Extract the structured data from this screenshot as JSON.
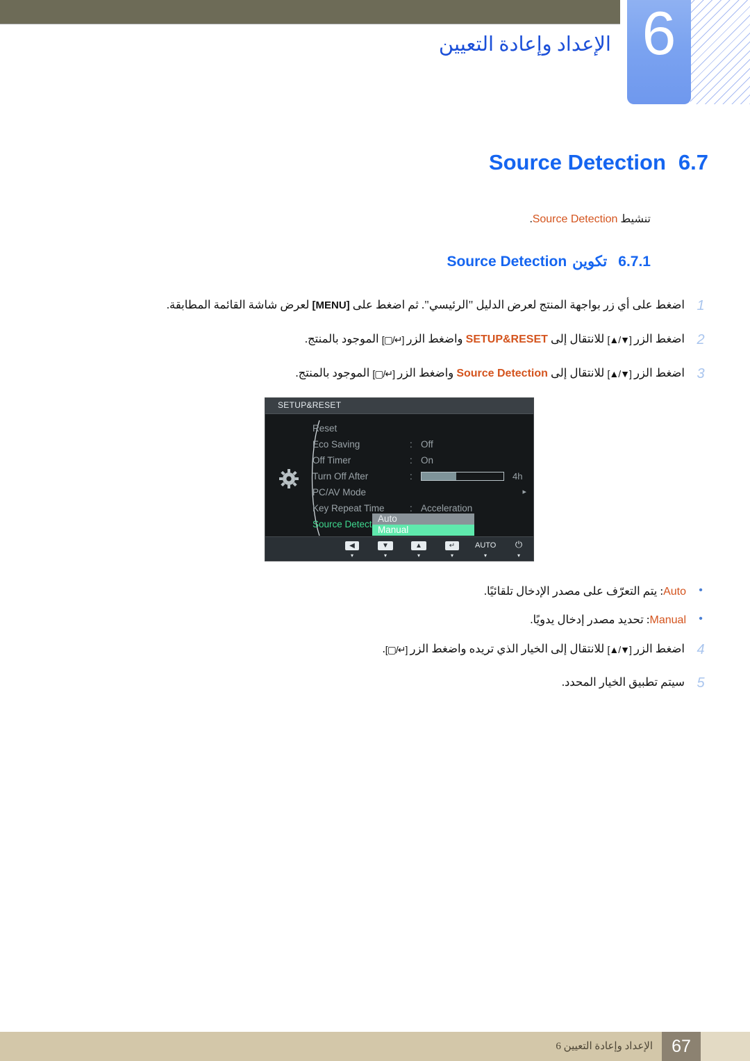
{
  "header": {
    "chapter_number": "6",
    "chapter_title": "الإعداد وإعادة التعيين"
  },
  "section": {
    "number": "6.7",
    "title_en": "Source Detection",
    "intro_ar": "تنشيط",
    "intro_en": "Source Detection",
    "intro_period": "."
  },
  "subsection": {
    "number": "6.7.1",
    "title_ar": "تكوين",
    "title_en": "Source Detection"
  },
  "steps": [
    {
      "num": "1",
      "parts": [
        {
          "t": "ar",
          "v": "اضغط على أي زر بواجهة المنتج لعرض الدليل \"الرئيسي\". ثم اضغط على "
        },
        {
          "t": "key",
          "v": "[MENU]"
        },
        {
          "t": "ar",
          "v": " لعرض شاشة القائمة المطابقة."
        }
      ]
    },
    {
      "num": "2",
      "parts": [
        {
          "t": "ar",
          "v": "اضغط الزر "
        },
        {
          "t": "arrowkey",
          "v": "[▲/▼]"
        },
        {
          "t": "ar",
          "v": " للانتقال إلى "
        },
        {
          "t": "eng",
          "v": "SETUP&RESET"
        },
        {
          "t": "ar",
          "v": " واضغط الزر "
        },
        {
          "t": "arrowkey",
          "v": "[▢/↵]"
        },
        {
          "t": "ar",
          "v": " الموجود بالمنتج."
        }
      ]
    },
    {
      "num": "3",
      "parts": [
        {
          "t": "ar",
          "v": "اضغط الزر "
        },
        {
          "t": "arrowkey",
          "v": "[▲/▼]"
        },
        {
          "t": "ar",
          "v": " للانتقال إلى "
        },
        {
          "t": "eng",
          "v": "Source Detection"
        },
        {
          "t": "ar",
          "v": " واضغط الزر "
        },
        {
          "t": "arrowkey",
          "v": "[▢/↵]"
        },
        {
          "t": "ar",
          "v": " الموجود بالمنتج."
        }
      ]
    },
    {
      "num": "4",
      "parts": [
        {
          "t": "ar",
          "v": "اضغط الزر "
        },
        {
          "t": "arrowkey",
          "v": "[▲/▼]"
        },
        {
          "t": "ar",
          "v": " للانتقال إلى الخيار الذي تريده واضغط الزر "
        },
        {
          "t": "arrowkey",
          "v": "[▢/↵]"
        },
        {
          "t": "ar",
          "v": "."
        }
      ]
    },
    {
      "num": "5",
      "parts": [
        {
          "t": "ar",
          "v": "سيتم تطبيق الخيار المحدد."
        }
      ]
    }
  ],
  "bullets": [
    {
      "dot": "•",
      "parts": [
        {
          "t": "eng",
          "v": "Auto"
        },
        {
          "t": "ar",
          "v": ": يتم التعرّف على مصدر الإدخال تلقائيًا."
        }
      ]
    },
    {
      "dot": "•",
      "parts": [
        {
          "t": "eng",
          "v": "Manual"
        },
        {
          "t": "ar",
          "v": ": تحديد مصدر إدخال يدويًا."
        }
      ]
    }
  ],
  "osd": {
    "title": "SETUP&RESET",
    "rows": [
      {
        "label": "Reset",
        "colon": "",
        "value": "",
        "kind": "plain"
      },
      {
        "label": "Eco Saving",
        "colon": ":",
        "value": "Off",
        "kind": "plain"
      },
      {
        "label": "Off Timer",
        "colon": ":",
        "value": "On",
        "kind": "plain"
      },
      {
        "label": "Turn Off After",
        "colon": ":",
        "value": "4h",
        "kind": "slider",
        "slider_pct": 42
      },
      {
        "label": "PC/AV Mode",
        "colon": "",
        "value": "",
        "kind": "submenu",
        "arrow": "▸"
      },
      {
        "label": "Key Repeat Time",
        "colon": ":",
        "value": "Acceleration",
        "kind": "plain"
      },
      {
        "label": "Source Detection",
        "colon": ":",
        "value": "",
        "kind": "selected"
      }
    ],
    "dropdown": {
      "options": [
        {
          "label": "Auto",
          "state": "normal"
        },
        {
          "label": "Manual",
          "state": "highlighted"
        }
      ]
    },
    "scroll_caret": "▾",
    "buttons": [
      {
        "glyph": "◀",
        "style": "cap",
        "tick": "▾"
      },
      {
        "glyph": "▼",
        "style": "cap",
        "tick": "▾"
      },
      {
        "glyph": "▲",
        "style": "cap",
        "tick": "▾"
      },
      {
        "glyph": "↵",
        "style": "cap",
        "tick": "▾"
      },
      {
        "glyph": "AUTO",
        "style": "text",
        "tick": "▾"
      },
      {
        "glyph": "⏻",
        "style": "pwr",
        "tick": "▾"
      }
    ],
    "colors": {
      "selected_label": "#3fd98f",
      "highlight_bg": "#5fe9ad",
      "option_bg": "#8a9399"
    }
  },
  "footer": {
    "page_number": "67",
    "text": "الإعداد وإعادة التعيين 6"
  }
}
